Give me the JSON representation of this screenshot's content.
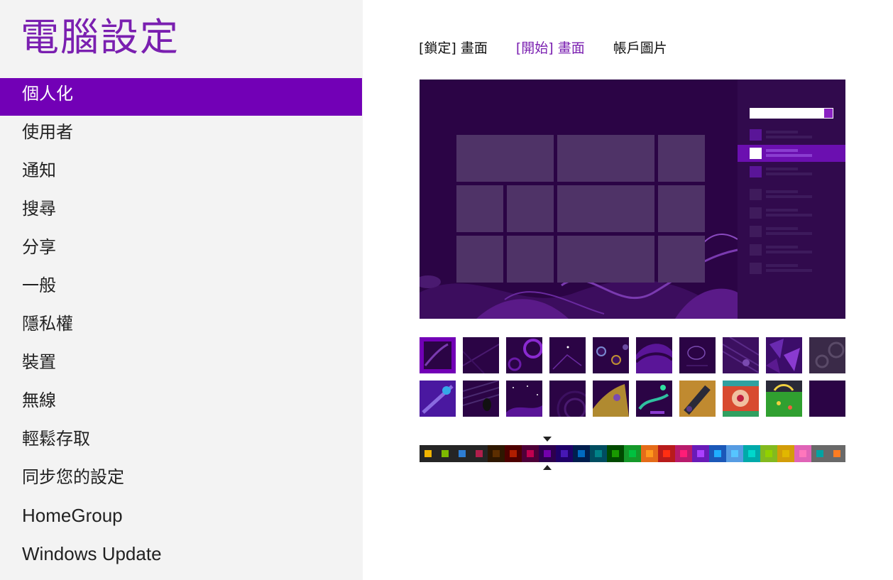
{
  "app_title": "電腦設定",
  "nav": [
    {
      "label": "個人化",
      "selected": true
    },
    {
      "label": "使用者"
    },
    {
      "label": "通知"
    },
    {
      "label": "搜尋"
    },
    {
      "label": "分享"
    },
    {
      "label": "一般"
    },
    {
      "label": "隱私權"
    },
    {
      "label": "裝置"
    },
    {
      "label": "無線"
    },
    {
      "label": "輕鬆存取"
    },
    {
      "label": "同步您的設定"
    },
    {
      "label": "HomeGroup"
    },
    {
      "label": "Windows Update"
    }
  ],
  "tabs": [
    {
      "label": "[鎖定] 畫面"
    },
    {
      "label": "[開始] 畫面",
      "active": true
    },
    {
      "label": "帳戶圖片"
    }
  ],
  "colors": {
    "accent": "#7a1fb0",
    "nav_selected_bg": "#7200b6",
    "sidebar_bg": "#f3f3f3",
    "preview_bg": "#2b0445",
    "tile": "#4f3367"
  },
  "patterns": {
    "rows": 2,
    "per_row": 10,
    "selected_index": 0
  },
  "color_swatches": [
    {
      "bg": "#252525",
      "dot": "#f0b400"
    },
    {
      "bg": "#252525",
      "dot": "#7dba00"
    },
    {
      "bg": "#252525",
      "dot": "#2d7dd2"
    },
    {
      "bg": "#252525",
      "dot": "#b01e4b"
    },
    {
      "bg": "#2e1700",
      "dot": "#5c2e00"
    },
    {
      "bg": "#4e0000",
      "dot": "#b01e00"
    },
    {
      "bg": "#4e0038",
      "dot": "#c1004f"
    },
    {
      "bg": "#2d004e",
      "dot": "#7200ac"
    },
    {
      "bg": "#1f0068",
      "dot": "#4617b4"
    },
    {
      "bg": "#001e4e",
      "dot": "#006ac1"
    },
    {
      "bg": "#004d60",
      "dot": "#008287"
    },
    {
      "bg": "#004a00",
      "dot": "#199900"
    },
    {
      "bg": "#15992a",
      "dot": "#00c13f"
    },
    {
      "bg": "#e56c19",
      "dot": "#ff981d"
    },
    {
      "bg": "#b81b1b",
      "dot": "#ff2e12"
    },
    {
      "bg": "#b81b6c",
      "dot": "#ff1d77"
    },
    {
      "bg": "#691bb8",
      "dot": "#aa40ff"
    },
    {
      "bg": "#1b58b8",
      "dot": "#1faeff"
    },
    {
      "bg": "#569ce3",
      "dot": "#56c5ff"
    },
    {
      "bg": "#00aaaa",
      "dot": "#00d8cc"
    },
    {
      "bg": "#83ba1f",
      "dot": "#91d100"
    },
    {
      "bg": "#d39d09",
      "dot": "#e1b700"
    },
    {
      "bg": "#e064b7",
      "dot": "#ff76bc"
    },
    {
      "bg": "#696969",
      "dot": "#00a3a3"
    },
    {
      "bg": "#696969",
      "dot": "#fe7c22"
    }
  ],
  "selected_color_index": 7,
  "icons": {
    "marker_top": "triangle-down-icon",
    "marker_bottom": "triangle-up-icon"
  }
}
